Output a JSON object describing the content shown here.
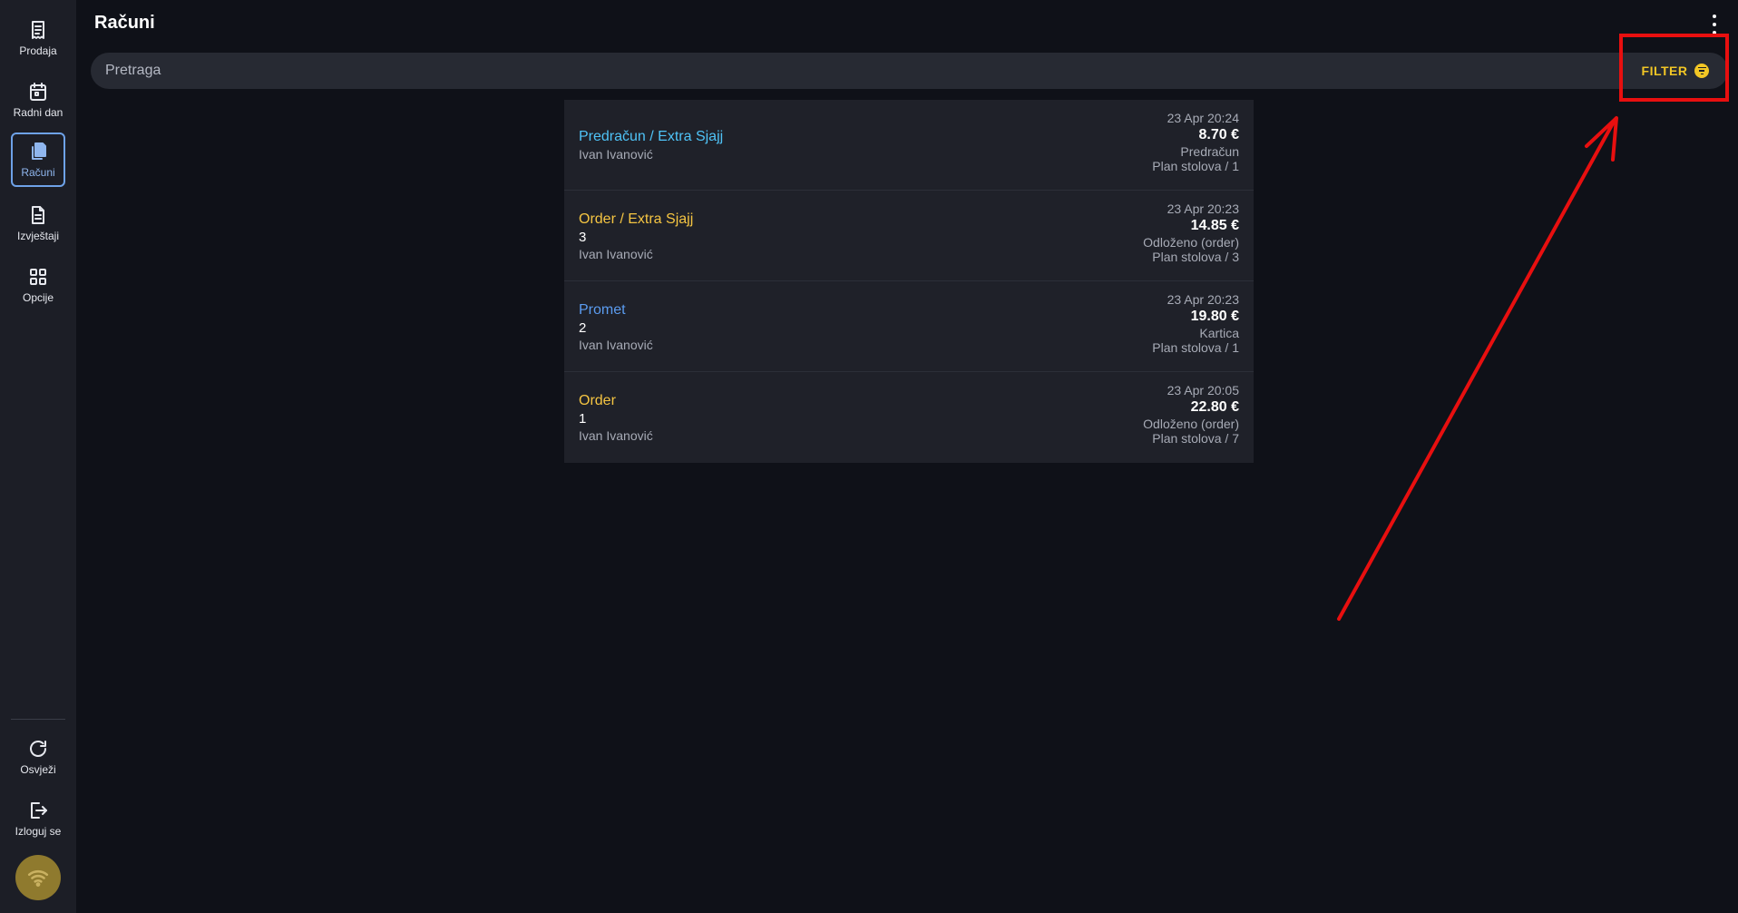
{
  "sidebar": {
    "items": [
      {
        "label": "Prodaja",
        "icon": "receipt-icon"
      },
      {
        "label": "Radni dan",
        "icon": "calendar-icon"
      },
      {
        "label": "Računi",
        "icon": "documents-icon",
        "active": true
      },
      {
        "label": "Izvještaji",
        "icon": "report-icon"
      },
      {
        "label": "Opcije",
        "icon": "grid-icon"
      }
    ],
    "bottom": [
      {
        "label": "Osvježi",
        "icon": "refresh-icon"
      },
      {
        "label": "Izloguj se",
        "icon": "logout-icon"
      }
    ],
    "status_icon": "wifi-icon"
  },
  "header": {
    "title": "Računi",
    "menu_icon": "more-vertical-icon"
  },
  "search": {
    "placeholder": "Pretraga",
    "value": ""
  },
  "filter": {
    "label": "FILTER",
    "icon": "filter-icon"
  },
  "colors": {
    "accent_yellow": "#f2c625",
    "accent_blue": "#6ea2e8",
    "title_cyan": "#4fc3f7",
    "title_yellow": "#f5c542",
    "title_blue": "#5b9cf0",
    "annotation_red": "#e80f0f"
  },
  "receipts": [
    {
      "title": "Predračun / Extra Sjajj",
      "title_color": "#4fc3f7",
      "number": "",
      "user": "Ivan Ivanović",
      "time": "23 Apr 20:24",
      "amount": "8.70 €",
      "status": "Predračun",
      "table": "Plan stolova / 1"
    },
    {
      "title": "Order / Extra Sjajj",
      "title_color": "#f5c542",
      "number": "3",
      "user": "Ivan Ivanović",
      "time": "23 Apr 20:23",
      "amount": "14.85 €",
      "status": "Odloženo (order)",
      "table": "Plan stolova / 3"
    },
    {
      "title": "Promet",
      "title_color": "#5b9cf0",
      "number": "2",
      "user": "Ivan Ivanović",
      "time": "23 Apr 20:23",
      "amount": "19.80 €",
      "status": "Kartica",
      "table": "Plan stolova / 1"
    },
    {
      "title": "Order",
      "title_color": "#f5c542",
      "number": "1",
      "user": "Ivan Ivanović",
      "time": "23 Apr 20:05",
      "amount": "22.80 €",
      "status": "Odloženo (order)",
      "table": "Plan stolova / 7"
    }
  ]
}
